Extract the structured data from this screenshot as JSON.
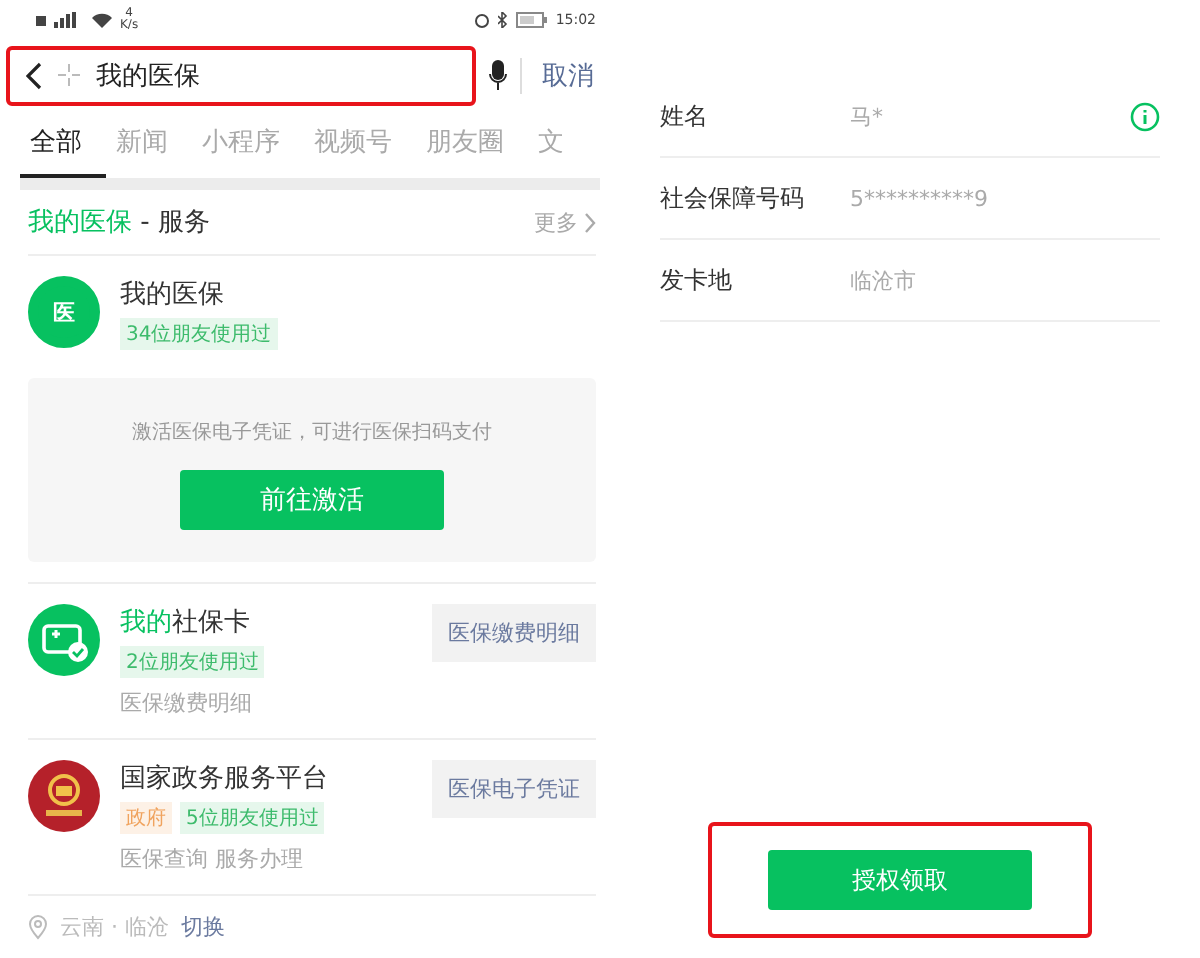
{
  "search_screen": {
    "status_bar": {
      "speed_value": "4",
      "speed_unit": "K/s",
      "time": "15:02"
    },
    "search": {
      "value": "我的医保",
      "highlighted": true,
      "cancel": "取消"
    },
    "tabs": [
      {
        "label": "全部",
        "selected": true
      },
      {
        "label": "新闻",
        "selected": false
      },
      {
        "label": "小程序",
        "selected": false
      },
      {
        "label": "视频号",
        "selected": false
      },
      {
        "label": "朋友圈",
        "selected": false
      },
      {
        "label": "文",
        "selected": false
      }
    ],
    "section": {
      "title_highlight": "我的医保",
      "title_rest": " - 服务",
      "more": "更多"
    },
    "results": [
      {
        "kind": "medical",
        "icon_text": "医",
        "title_rest": "我的医保",
        "tags": [
          {
            "kind": "friends",
            "text": "34位朋友使用过"
          }
        ],
        "activation": {
          "text": "激活医保电子凭证，可进行医保扫码支付",
          "button": "前往激活"
        }
      },
      {
        "kind": "card",
        "title_highlight": "我的",
        "title_rest": "社保卡",
        "tags": [
          {
            "kind": "friends",
            "text": "2位朋友使用过"
          }
        ],
        "description": "医保缴费明细",
        "action": "医保缴费明细"
      },
      {
        "kind": "emblem",
        "title_rest": "国家政务服务平台",
        "tags": [
          {
            "kind": "government",
            "text": "政府"
          },
          {
            "kind": "friends",
            "text": "5位朋友使用过"
          }
        ],
        "description": "医保查询 服务办理",
        "action": "医保电子凭证"
      }
    ],
    "location": {
      "place": "云南 · 临沧",
      "switch": "切换"
    }
  },
  "card_screen": {
    "fields": [
      {
        "label": "姓名",
        "value": "马*",
        "info": true
      },
      {
        "label": "社会保障号码",
        "value": "5**********9",
        "info": false
      },
      {
        "label": "发卡地",
        "value": "临沧市",
        "info": false
      }
    ],
    "button": {
      "label": "授权领取",
      "highlighted": true
    }
  }
}
